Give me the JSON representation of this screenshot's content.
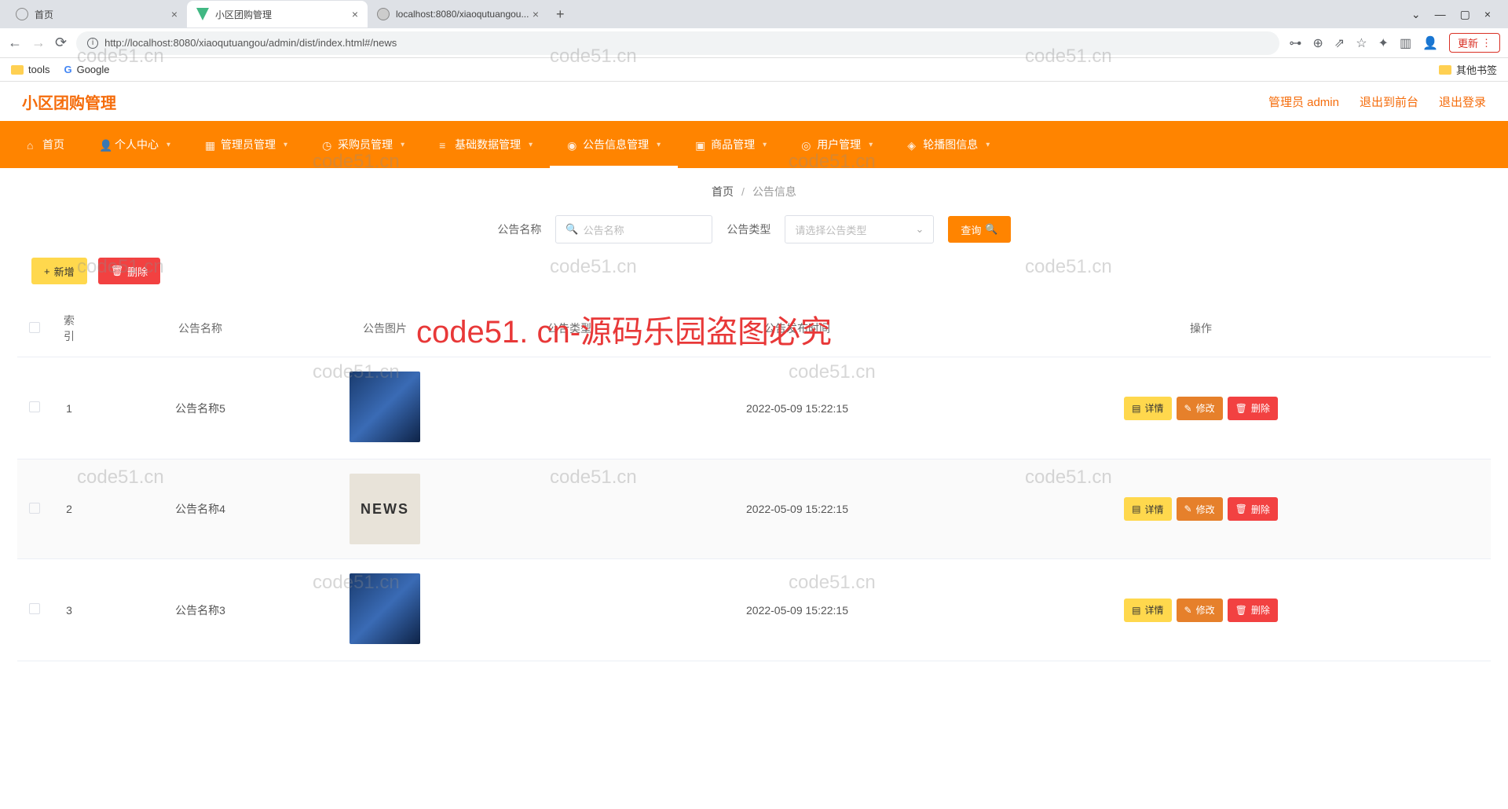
{
  "browser": {
    "tabs": [
      {
        "title": "首页",
        "active": false
      },
      {
        "title": "小区团购管理",
        "active": true
      },
      {
        "title": "localhost:8080/xiaoqutuangou...",
        "active": false
      }
    ],
    "url": "http://localhost:8080/xiaoqutuangou/admin/dist/index.html#/news",
    "update_btn": "更新",
    "bookmarks": {
      "tools": "tools",
      "google": "Google",
      "other": "其他书签"
    }
  },
  "header": {
    "title": "小区团购管理",
    "admin": "管理员 admin",
    "logout_front": "退出到前台",
    "logout": "退出登录"
  },
  "nav": {
    "items": [
      {
        "label": "首页"
      },
      {
        "label": "个人中心"
      },
      {
        "label": "管理员管理"
      },
      {
        "label": "采购员管理"
      },
      {
        "label": "基础数据管理"
      },
      {
        "label": "公告信息管理"
      },
      {
        "label": "商品管理"
      },
      {
        "label": "用户管理"
      },
      {
        "label": "轮播图信息"
      }
    ]
  },
  "breadcrumb": {
    "home": "首页",
    "current": "公告信息"
  },
  "search": {
    "name_label": "公告名称",
    "name_placeholder": "公告名称",
    "type_label": "公告类型",
    "type_placeholder": "请选择公告类型",
    "query_btn": "查询"
  },
  "actions": {
    "add": "新增",
    "delete": "删除"
  },
  "table": {
    "headers": {
      "index": "索引",
      "name": "公告名称",
      "image": "公告图片",
      "type": "公告类型",
      "time": "公告发布时间",
      "ops": "操作"
    },
    "ops": {
      "detail": "详情",
      "edit": "修改",
      "delete": "删除"
    },
    "rows": [
      {
        "index": "1",
        "name": "公告名称5",
        "img": "globe",
        "time": "2022-05-09 15:22:15"
      },
      {
        "index": "2",
        "name": "公告名称4",
        "img": "news",
        "time": "2022-05-09 15:22:15"
      },
      {
        "index": "3",
        "name": "公告名称3",
        "img": "globe",
        "time": "2022-05-09 15:22:15"
      }
    ]
  },
  "watermarks": {
    "gray": "code51.cn",
    "red": "code51. cn-源码乐园盗图必究",
    "news_text": "NEWS"
  }
}
